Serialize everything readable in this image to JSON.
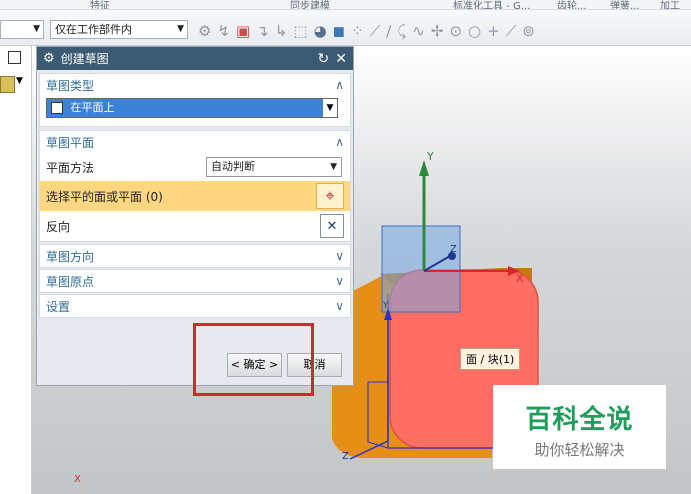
{
  "ribbon": {
    "groups": [
      "特征",
      "同步建模",
      "标准化工具 - G...",
      "齿轮...",
      "弹簧...",
      "加工"
    ]
  },
  "toolbar": {
    "filter_value": "仅在工作部件内"
  },
  "dialog": {
    "title": "创建草图",
    "sections": {
      "sketch_type": {
        "header": "草图类型",
        "value": "在平面上"
      },
      "sketch_plane": {
        "header": "草图平面",
        "plane_method_label": "平面方法",
        "plane_method_value": "自动判断",
        "select_label": "选择平的面或平面 (0)",
        "reverse_label": "反向"
      },
      "sketch_orientation": {
        "header": "草图方向"
      },
      "sketch_origin": {
        "header": "草图原点"
      },
      "settings": {
        "header": "设置"
      }
    },
    "ok_label": "< 确定 >",
    "cancel_label": "取消"
  },
  "viewport": {
    "axis_y": "Y",
    "axis_x": "X",
    "axis_z": "Z",
    "face_label": "面 / 块(1)"
  },
  "watermark": {
    "brand": "百科全说",
    "tagline": "助你轻松解决"
  },
  "colors": {
    "face_highlight": "#ff6e63",
    "body_orange": "#e58f16",
    "selection_yellow": "#ffd780",
    "annotation_red": "#d6262e"
  }
}
